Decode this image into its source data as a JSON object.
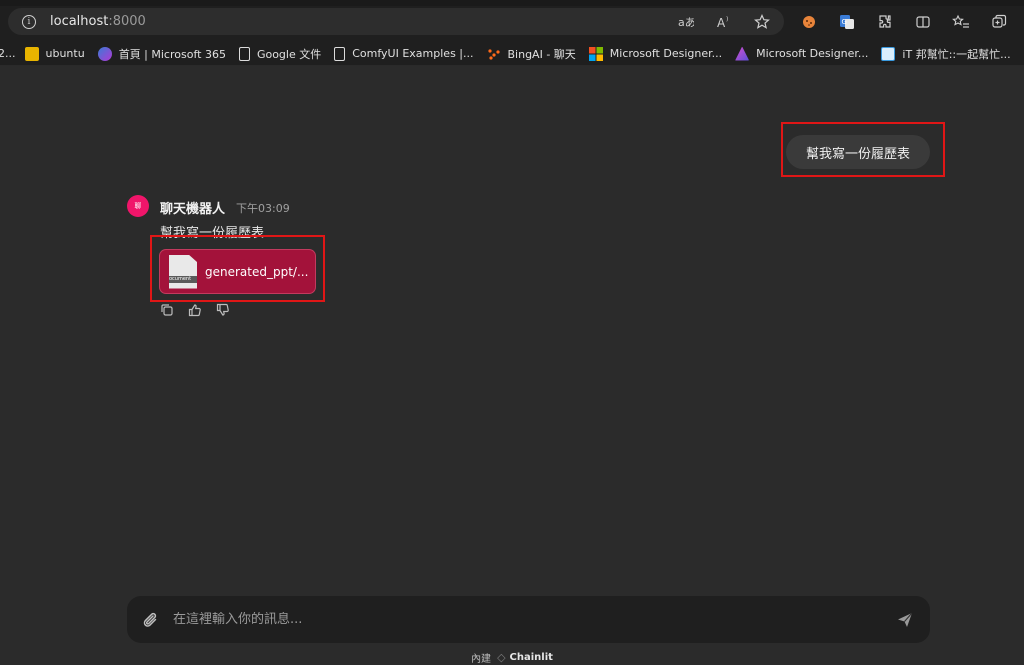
{
  "browser": {
    "url_host": "localhost",
    "url_port": ":8000",
    "bookmarks": [
      {
        "label": "2...",
        "color": "#444444"
      },
      {
        "label": "ubuntu",
        "color": "#e8b400"
      },
      {
        "label": "首頁 | Microsoft 365",
        "color": "#6a4bd0"
      },
      {
        "label": "Google 文件",
        "color": "#dcdcdc"
      },
      {
        "label": "ComfyUI Examples |...",
        "color": "#dcdcdc"
      },
      {
        "label": "BingAI - 聊天",
        "color": "#ff6a1a"
      },
      {
        "label": "Microsoft Designer...",
        "color": "#3fa34d"
      },
      {
        "label": "Microsoft Designer...",
        "color": "#8a4fd8"
      },
      {
        "label": "iT 邦幫忙::一起幫忙...",
        "color": "#3a9adf"
      }
    ]
  },
  "chat": {
    "user_message": "幫我寫一份履歷表",
    "bot": {
      "name": "聊天機器人",
      "avatar_text": "聊",
      "time": "下午03:09",
      "text": "幫我寫一份履歷表",
      "file": {
        "name": "generated_ppt/...",
        "icon_label": "ocument"
      }
    },
    "composer": {
      "placeholder": "在這裡輸入你的訊息..."
    }
  },
  "footer": {
    "prefix": "內建",
    "brand": "Chainlit"
  },
  "colors": {
    "accent_red_box": "#e01616",
    "bot_avatar": "#f0156a",
    "file_card": "#a3123a"
  }
}
